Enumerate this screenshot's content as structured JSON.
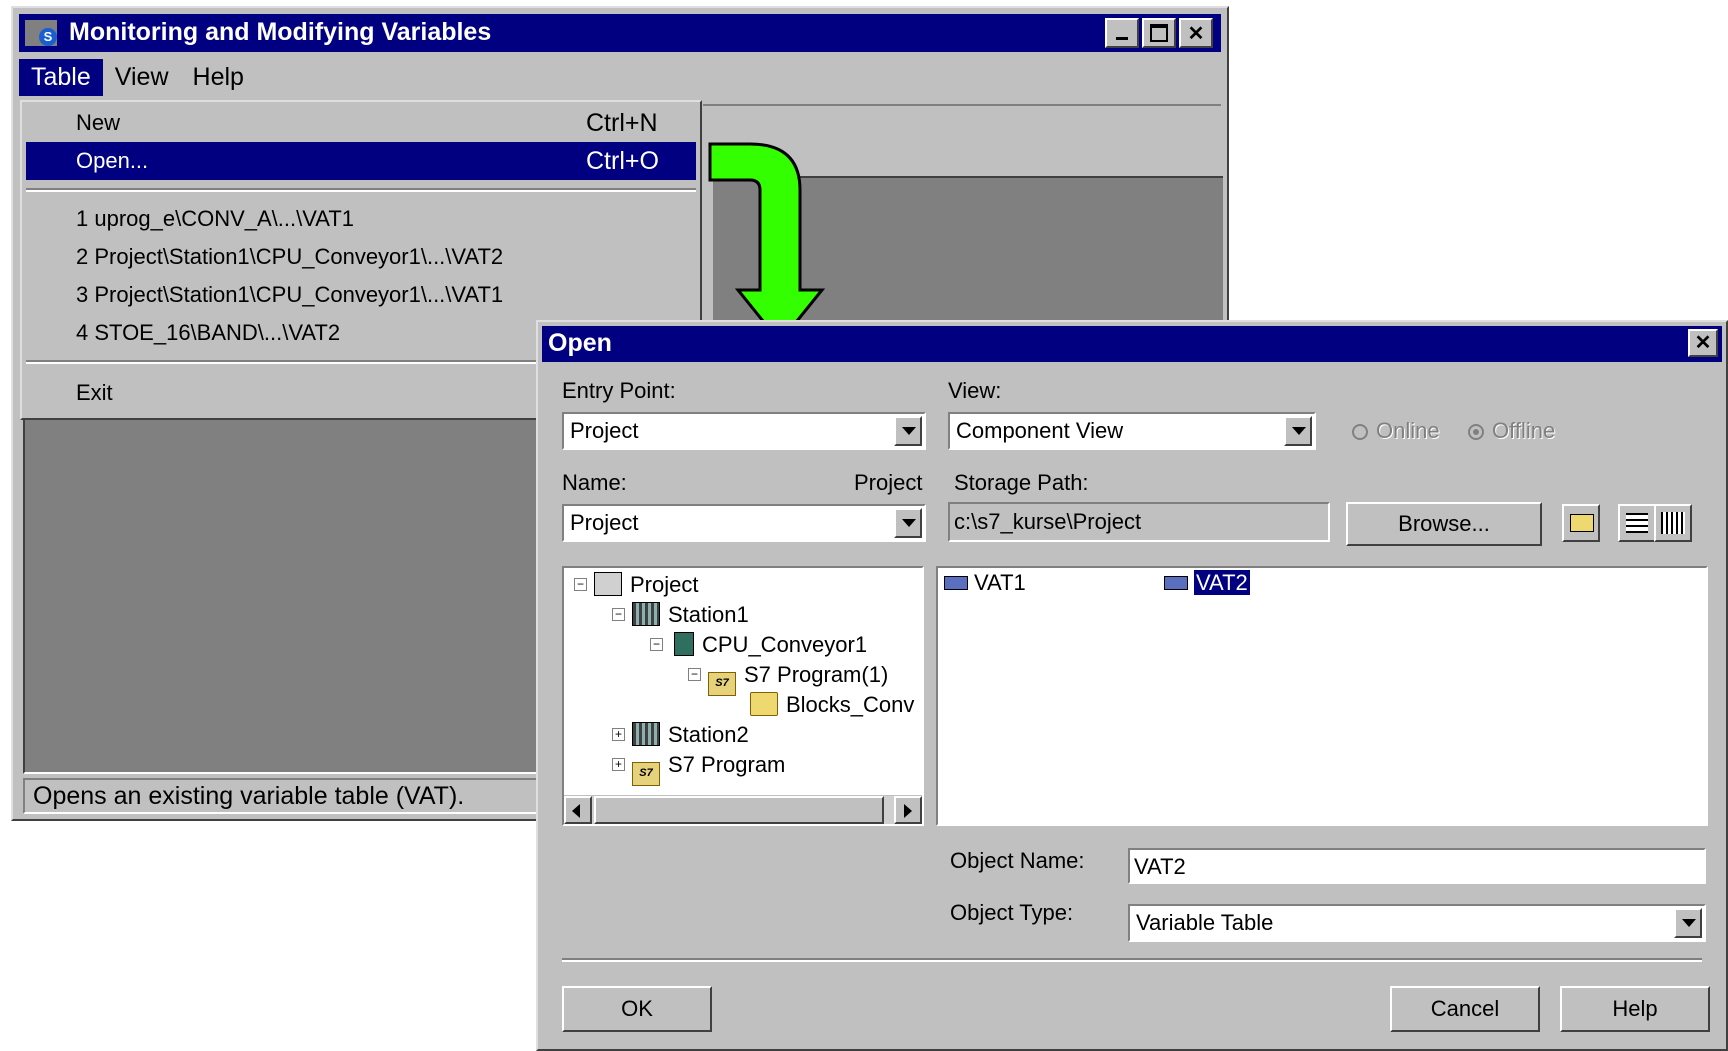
{
  "main_window": {
    "title": "Monitoring and Modifying Variables",
    "menu": [
      "Table",
      "View",
      "Help"
    ],
    "caption_buttons": [
      "minimize",
      "maximize",
      "close"
    ],
    "status_text": "Opens an existing variable table (VAT)."
  },
  "table_menu": {
    "new_label": "New",
    "new_shortcut": "Ctrl+N",
    "open_label": "Open...",
    "open_shortcut": "Ctrl+O",
    "recent": [
      "1 uprog_e\\CONV_A\\...\\VAT1",
      "2 Project\\Station1\\CPU_Conveyor1\\...\\VAT2",
      "3 Project\\Station1\\CPU_Conveyor1\\...\\VAT1",
      "4 STOE_16\\BAND\\...\\VAT2"
    ],
    "exit_label": "Exit"
  },
  "open_dialog": {
    "title": "Open",
    "entry_point_label": "Entry Point:",
    "entry_point_value": "Project",
    "view_label": "View:",
    "view_value": "Component View",
    "online_label": "Online",
    "offline_label": "Offline",
    "name_label": "Name:",
    "name_type": "Project",
    "name_value": "Project",
    "storage_path_label": "Storage Path:",
    "storage_path_value": "c:\\s7_kurse\\Project",
    "browse_label": "Browse...",
    "tree": {
      "project": "Project",
      "station1": "Station1",
      "cpu": "CPU_Conveyor1",
      "s7_program1": "S7 Program(1)",
      "blocks": "Blocks_Conv",
      "station2": "Station2",
      "s7_program": "S7 Program"
    },
    "list_items": [
      "VAT1",
      "VAT2"
    ],
    "selected_item": "VAT2",
    "object_name_label": "Object Name:",
    "object_name_value": "VAT2",
    "object_type_label": "Object Type:",
    "object_type_value": "Variable Table",
    "ok_label": "OK",
    "cancel_label": "Cancel",
    "help_label": "Help"
  },
  "colors": {
    "title_bar": "#000080",
    "face": "#c0c0c0",
    "arrow": "#33ff00"
  }
}
